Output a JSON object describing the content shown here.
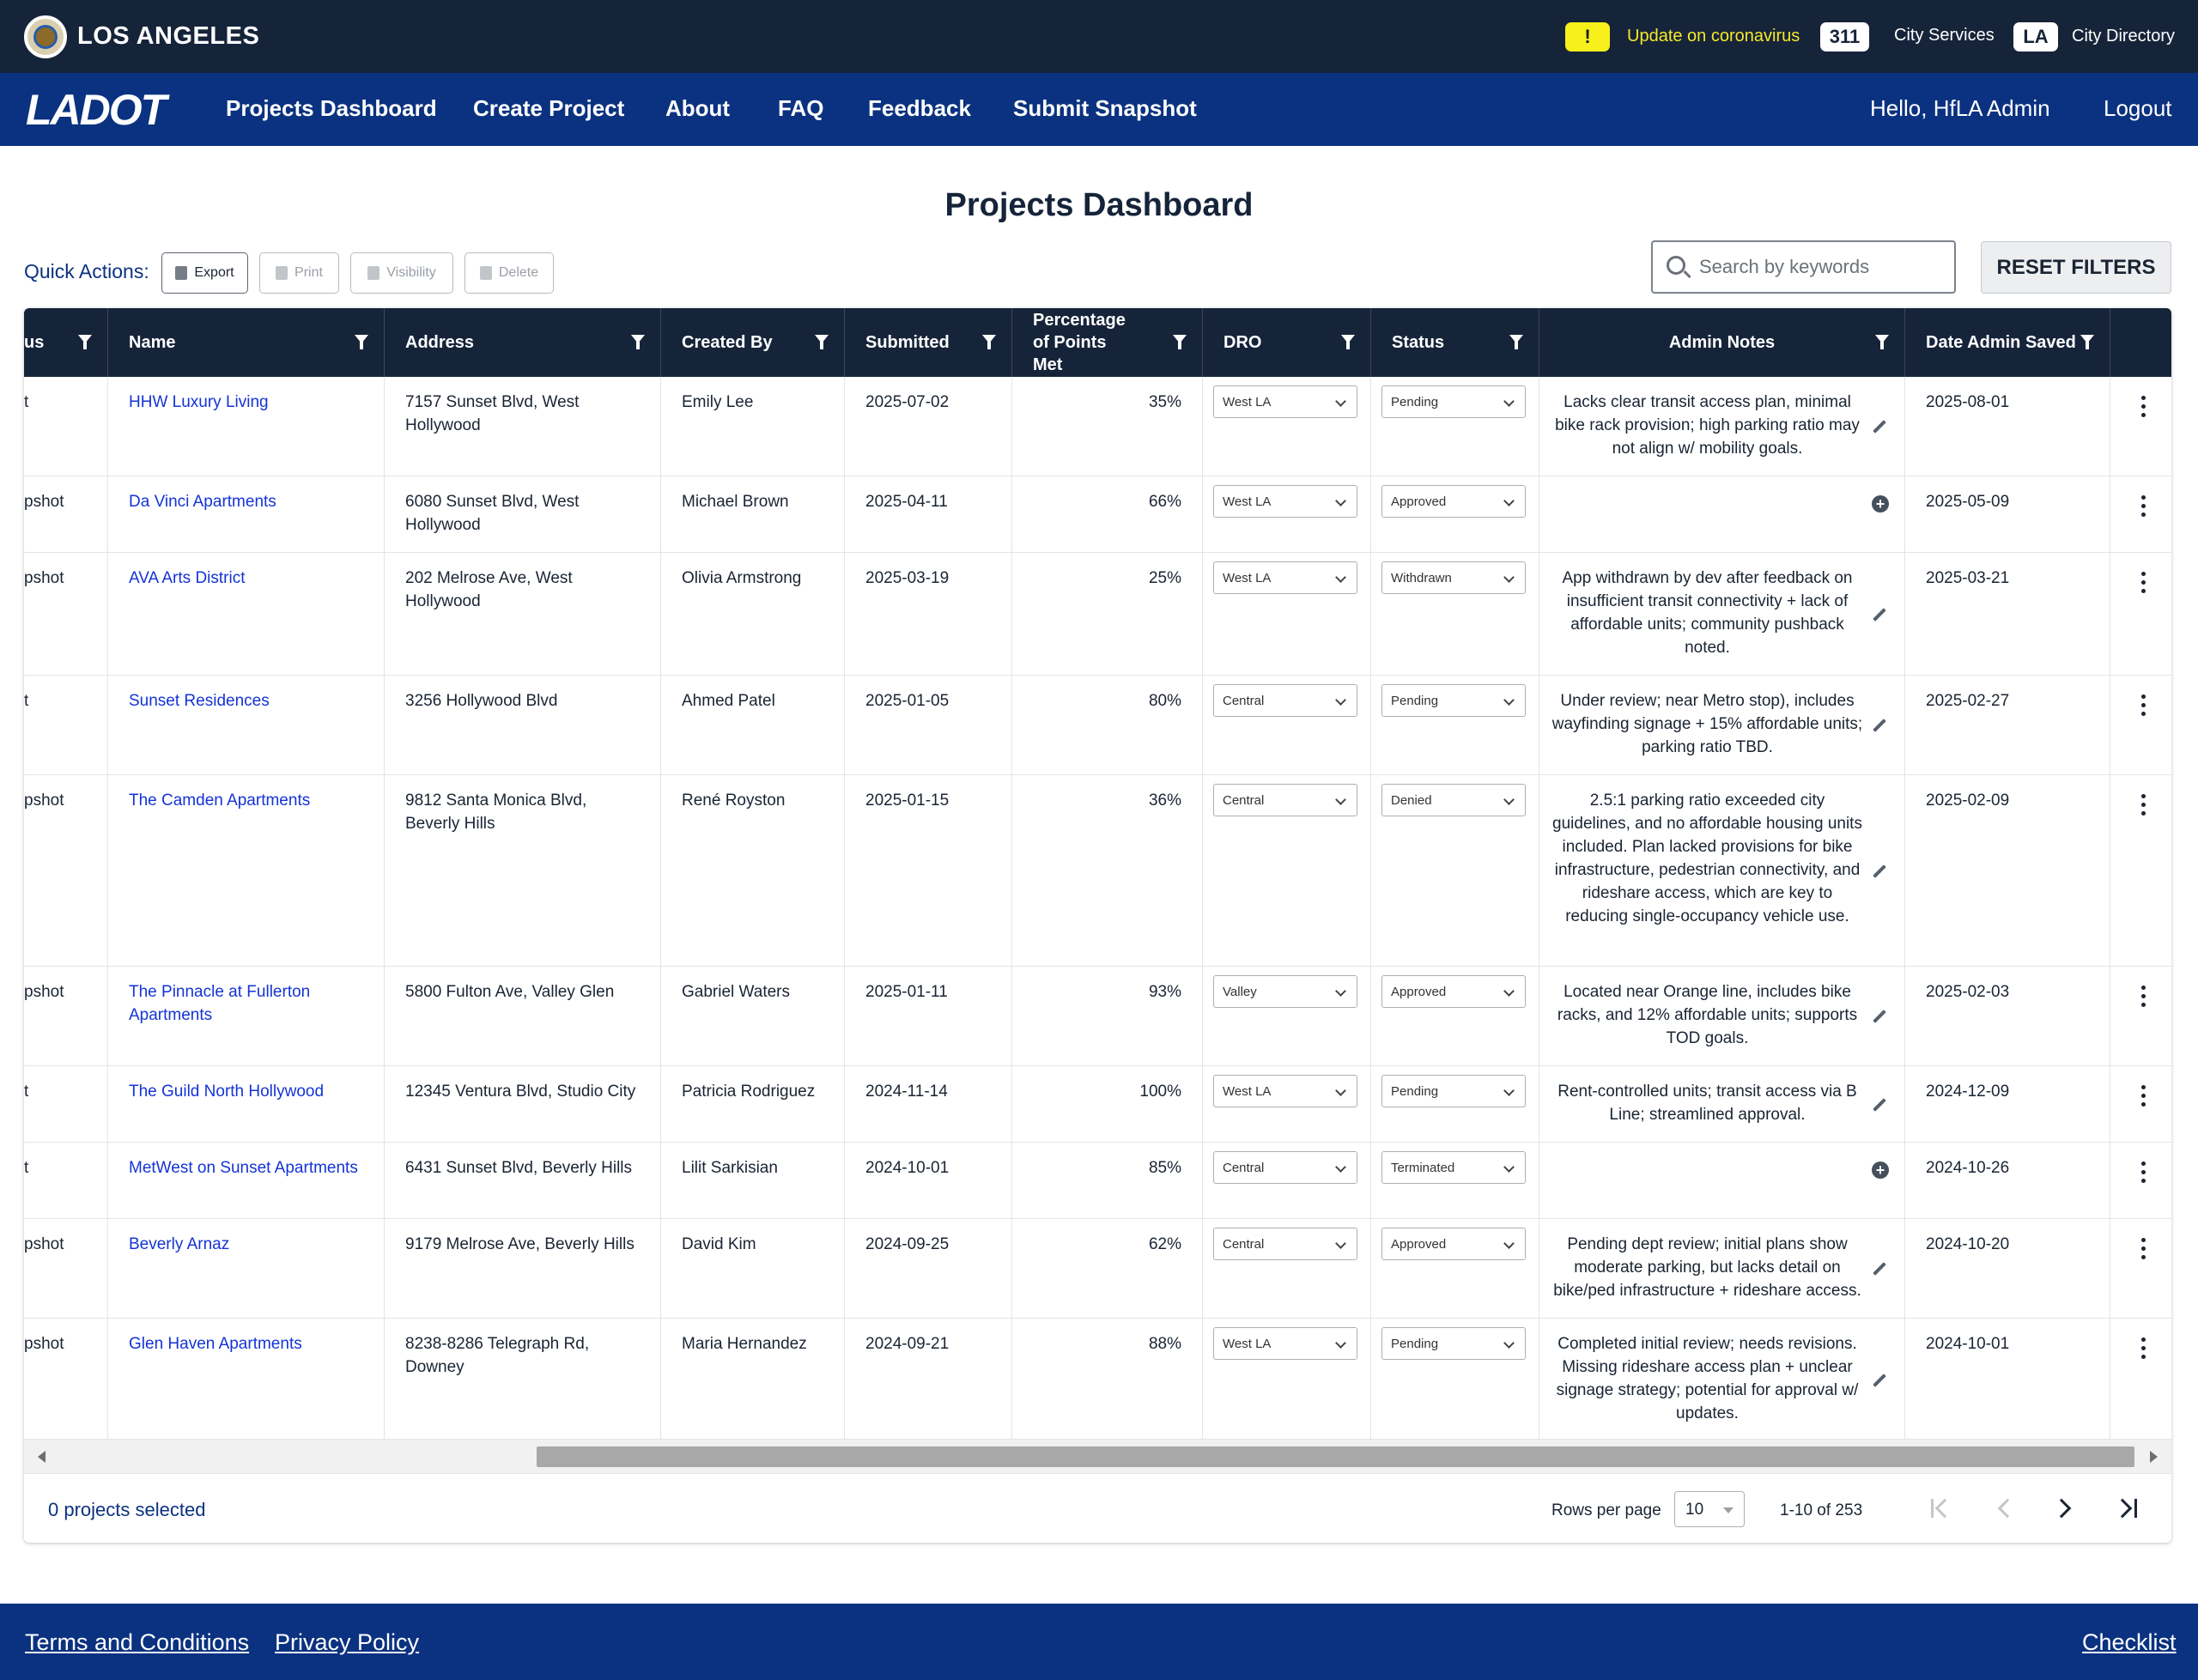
{
  "city_bar": {
    "city_name": "LOS ANGELES",
    "alert_badge": "!",
    "alert_text": "Update on coronavirus",
    "badge_311": "311",
    "city_services": "City Services",
    "badge_la": "LA",
    "city_directory": "City Directory"
  },
  "nav": {
    "logo": "LADOT",
    "items": [
      "Projects Dashboard",
      "Create Project",
      "About",
      "FAQ",
      "Feedback",
      "Submit Snapshot"
    ],
    "greeting": "Hello, HfLA Admin",
    "logout": "Logout"
  },
  "page": {
    "title": "Projects Dashboard",
    "quick_actions_label": "Quick Actions:",
    "quick_actions": [
      "Export",
      "Print",
      "Visibility",
      "Delete"
    ],
    "search_placeholder": "Search by keywords",
    "reset_filters": "RESET FILTERS"
  },
  "table": {
    "columns": [
      "us",
      "Name",
      "Address",
      "Created By",
      "Submitted",
      "Percentage of Points Met",
      "DRO",
      "Status",
      "Admin Notes",
      "Date Admin Saved"
    ],
    "rows": [
      {
        "type": "t",
        "name": "HHW Luxury Living",
        "address": "7157 Sunset Blvd, West Hollywood",
        "created_by": "Emily Lee",
        "submitted": "2025-07-02",
        "pct": "35%",
        "dro": "West LA",
        "status": "Pending",
        "notes": "Lacks clear transit access plan, minimal bike rack provision; high parking ratio may not align w/ mobility goals.",
        "date_saved": "2025-08-01"
      },
      {
        "type": "pshot",
        "name": "Da Vinci Apartments",
        "address": "6080 Sunset Blvd, West Hollywood",
        "created_by": "Michael Brown",
        "submitted": "2025-04-11",
        "pct": "66%",
        "dro": "West LA",
        "status": "Approved",
        "notes": "",
        "date_saved": "2025-05-09"
      },
      {
        "type": "pshot",
        "name": "AVA Arts District",
        "address": "202 Melrose Ave, West Hollywood",
        "created_by": "Olivia Armstrong",
        "submitted": "2025-03-19",
        "pct": "25%",
        "dro": "West LA",
        "status": "Withdrawn",
        "notes": "App withdrawn by dev after feedback on insufficient transit connectivity + lack of affordable units; community pushback noted.",
        "date_saved": "2025-03-21"
      },
      {
        "type": "t",
        "name": "Sunset Residences",
        "address": "3256 Hollywood Blvd",
        "created_by": "Ahmed Patel",
        "submitted": "2025-01-05",
        "pct": "80%",
        "dro": "Central",
        "status": "Pending",
        "notes": "Under review; near Metro stop), includes wayfinding signage + 15% affordable units; parking ratio TBD.",
        "date_saved": "2025-02-27"
      },
      {
        "type": "pshot",
        "name": "The Camden Apartments",
        "address": "9812 Santa Monica Blvd, Beverly Hills",
        "created_by": "René Royston",
        "submitted": "2025-01-15",
        "pct": "36%",
        "dro": "Central",
        "status": "Denied",
        "notes": "2.5:1 parking ratio exceeded city guidelines, and no affordable housing units included. Plan lacked provisions for bike infrastructure, pedestrian connectivity, and rideshare access, which are key to reducing single-occupancy vehicle use.",
        "date_saved": "2025-02-09"
      },
      {
        "type": "pshot",
        "name": "The Pinnacle at Fullerton Apartments",
        "address": "5800 Fulton Ave, Valley Glen",
        "created_by": "Gabriel Waters",
        "submitted": "2025-01-11",
        "pct": "93%",
        "dro": "Valley",
        "status": "Approved",
        "notes": "Located near Orange line, includes bike racks, and 12% affordable units; supports TOD goals.",
        "date_saved": "2025-02-03"
      },
      {
        "type": "t",
        "name": "The Guild North Hollywood",
        "address": "12345 Ventura Blvd, Studio City",
        "created_by": "Patricia Rodriguez",
        "submitted": "2024-11-14",
        "pct": "100%",
        "dro": "West LA",
        "status": "Pending",
        "notes": "Rent-controlled units; transit access via B Line; streamlined approval.",
        "date_saved": "2024-12-09"
      },
      {
        "type": "t",
        "name": "MetWest on Sunset Apartments",
        "address": "6431 Sunset Blvd, Beverly Hills",
        "created_by": "Lilit Sarkisian",
        "submitted": "2024-10-01",
        "pct": "85%",
        "dro": "Central",
        "status": "Terminated",
        "notes": "",
        "date_saved": "2024-10-26"
      },
      {
        "type": "pshot",
        "name": "Beverly Arnaz",
        "address": "9179 Melrose Ave, Beverly Hills",
        "created_by": "David Kim",
        "submitted": "2024-09-25",
        "pct": "62%",
        "dro": "Central",
        "status": "Approved",
        "notes": "Pending dept review; initial plans show moderate parking, but lacks detail on bike/ped infrastructure + rideshare access.",
        "date_saved": "2024-10-20"
      },
      {
        "type": "pshot",
        "name": "Glen Haven Apartments",
        "address": "8238-8286 Telegraph Rd, Downey",
        "created_by": "Maria Hernandez",
        "submitted": "2024-09-21",
        "pct": "88%",
        "dro": "West LA",
        "status": "Pending",
        "notes": "Completed initial review; needs revisions. Missing rideshare access plan + unclear signage strategy; potential for approval w/ updates.",
        "date_saved": "2024-10-01"
      }
    ]
  },
  "pagination": {
    "selected": "0 projects selected",
    "rows_per_page_label": "Rows per page",
    "rows_per_page": "10",
    "range": "1-10 of 253"
  },
  "footer": {
    "terms": "Terms and Conditions",
    "privacy": "Privacy Policy",
    "checklist": "Checklist"
  },
  "colors": {
    "city_bar": "#16243a",
    "nav_bar": "#0b3280",
    "link": "#1433d6",
    "alert": "#f8f01c"
  },
  "icons": [
    "city-seal-icon",
    "search-icon",
    "filter-icon",
    "edit-icon",
    "add-note-icon",
    "more-vert-icon",
    "first-page-icon",
    "prev-page-icon",
    "next-page-icon",
    "last-page-icon"
  ]
}
